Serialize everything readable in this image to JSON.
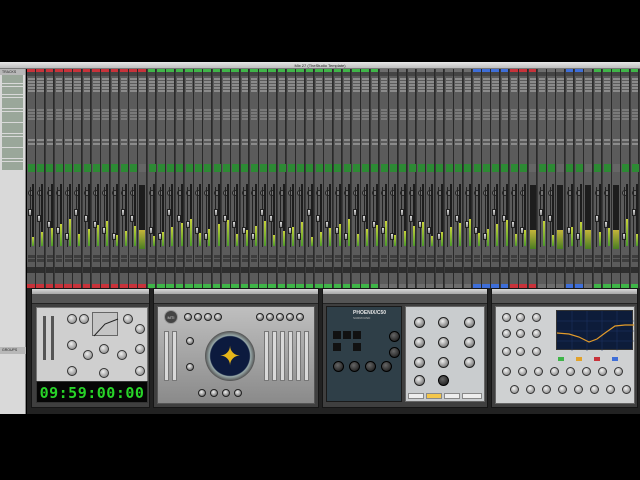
{
  "window": {
    "title": "Mix 27 (TheStudio Template)"
  },
  "tracklist": {
    "header": "TRACKS",
    "groups_header": "GROUPS"
  },
  "timecode": "09:59:00:00",
  "colors": {
    "accent_green": "#2d8a34",
    "timecode_green": "#28d428",
    "strip_red": "#c8323a",
    "strip_green": "#3fb548",
    "strip_blue": "#3e6ed8",
    "phoenix_panel": "#2f3f48",
    "eq_display": "#0d1c3a"
  },
  "plugins": {
    "phoenix": {
      "brand": "PHOENIX/C50",
      "subtitle": "SURROUND"
    },
    "console": {
      "badge": "MTI"
    }
  },
  "icons": [
    "close-icon",
    "minimize-icon",
    "maximize-icon",
    "knob-icon",
    "fader-icon",
    "meter-icon"
  ]
}
